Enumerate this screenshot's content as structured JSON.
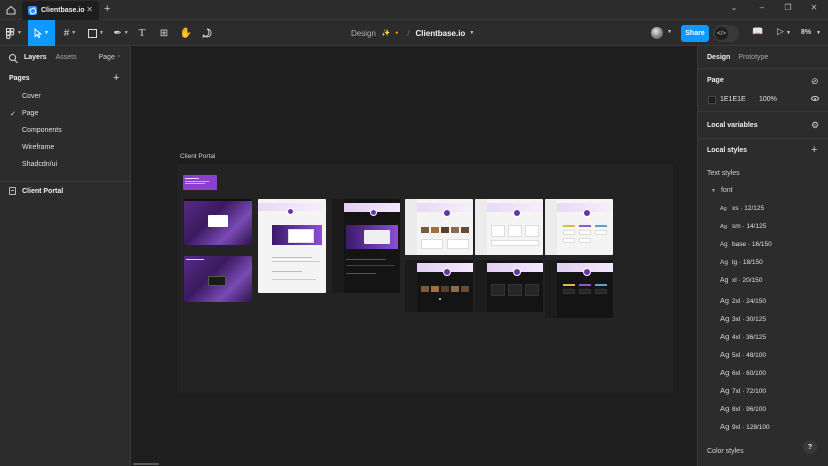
{
  "tabbar": {
    "tab_title": "Clientbase.io",
    "new_tab": "+"
  },
  "toolbar": {
    "crumb_design": "Design",
    "crumb_emoji": "✨ 🔸",
    "crumb_slash": "/",
    "file_name": "Clientbase.io",
    "share_label": "Share",
    "zoom": "8%"
  },
  "left_panel": {
    "tab_layers": "Layers",
    "tab_assets": "Assets",
    "page_selector": "Page",
    "pages_header": "Pages",
    "pages": [
      {
        "label": "Cover",
        "current": false
      },
      {
        "label": "Page",
        "current": true
      },
      {
        "label": "Components",
        "current": false
      },
      {
        "label": "Wireframe",
        "current": false
      },
      {
        "label": "Shadcdn/ui",
        "current": false
      }
    ],
    "layers": [
      {
        "label": "Client Portal"
      }
    ]
  },
  "canvas": {
    "frame_label": "Client Portal"
  },
  "right_panel": {
    "tab_design": "Design",
    "tab_prototype": "Prototype",
    "page_section": "Page",
    "background_hex": "1E1E1E",
    "background_opacity": "100%",
    "local_variables": "Local variables",
    "local_styles": "Local styles",
    "text_styles": "Text styles",
    "font_group": "font",
    "styles": [
      {
        "ag": "Ag",
        "name": "xs · 12/125"
      },
      {
        "ag": "Ag",
        "name": "sm · 14/125"
      },
      {
        "ag": "Ag",
        "name": "base · 16/150"
      },
      {
        "ag": "Ag",
        "name": "lg · 18/150"
      },
      {
        "ag": "Ag",
        "name": "xl · 20/150"
      },
      {
        "ag": "Ag",
        "name": "2xl · 24/150"
      },
      {
        "ag": "Ag",
        "name": "3xl · 30/125"
      },
      {
        "ag": "Ag",
        "name": "4xl · 36/125"
      },
      {
        "ag": "Ag",
        "name": "5xl · 48/100"
      },
      {
        "ag": "Ag",
        "name": "6xl · 60/100"
      },
      {
        "ag": "Ag",
        "name": "7xl · 72/100"
      },
      {
        "ag": "Ag",
        "name": "8xl · 96/100"
      },
      {
        "ag": "Ag",
        "name": "9xl · 128/100"
      }
    ],
    "color_styles": "Color styles"
  },
  "help": "?"
}
